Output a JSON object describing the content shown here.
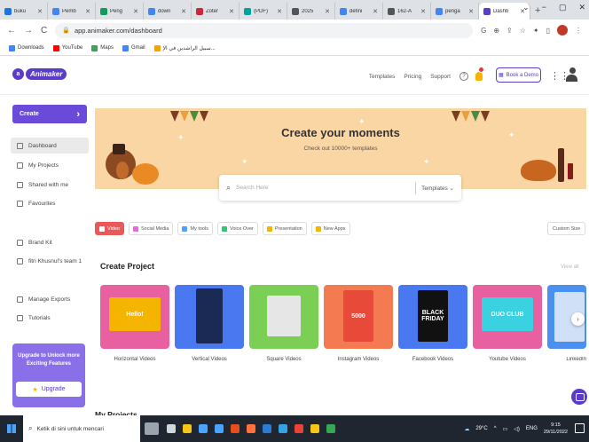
{
  "browser": {
    "tabs": [
      {
        "label": "buku",
        "color": "#1a73e8"
      },
      {
        "label": "Pemb",
        "color": "#4285f4"
      },
      {
        "label": "Peng",
        "color": "#0f9d58"
      },
      {
        "label": "down",
        "color": "#4285f4"
      },
      {
        "label": "Zoter",
        "color": "#cc2936"
      },
      {
        "label": "(PDF)",
        "color": "#00a39b"
      },
      {
        "label": "2025",
        "color": "#555555"
      },
      {
        "label": "defini",
        "color": "#4285f4"
      },
      {
        "label": "162-A",
        "color": "#555555"
      },
      {
        "label": "penga",
        "color": "#4285f4"
      },
      {
        "label": "Dashb",
        "color": "#5a3cc9",
        "active": true
      }
    ],
    "new_tab": "+",
    "window_controls": {
      "down": "⌄",
      "minimize": "−",
      "restore": "▢",
      "close": "✕"
    },
    "address": {
      "url": "app.animaker.com/dashboard",
      "lock_icon": "lock-icon"
    },
    "bookmarks": [
      {
        "label": "Downloads",
        "color": "#4285f4"
      },
      {
        "label": "YouTube",
        "color": "#ff0000"
      },
      {
        "label": "Maps",
        "color": "#34a853"
      },
      {
        "label": "Gmail",
        "color": "#4285f4"
      },
      {
        "label": "سبيل الراشدين في الإ...",
        "color": "#f4a300"
      }
    ]
  },
  "app": {
    "logo_text": "Animaker",
    "nav": {
      "templates": "Templates",
      "pricing": "Pricing",
      "support": "Support",
      "help": "?"
    },
    "book_demo": "Book a Demo",
    "colors": {
      "brand": "#5a3cc9",
      "banner": "#fbd6a5",
      "active_chip": "#e85a5a"
    }
  },
  "sidebar": {
    "create": "Create",
    "create_arrow": "›",
    "items": [
      {
        "label": "Dashboard",
        "active": true
      },
      {
        "label": "My Projects"
      },
      {
        "label": "Shared with me"
      },
      {
        "label": "Favourites"
      },
      {
        "label": "Brand Kit"
      },
      {
        "label": "fitri Khusnul's team 1"
      },
      {
        "label": "Manage Exports"
      },
      {
        "label": "Tutorials"
      }
    ],
    "upgrade": {
      "text": "Upgrade to Unlock more Exciting Features",
      "button": "Upgrade",
      "star": "★"
    }
  },
  "banner": {
    "title": "Create your moments",
    "subtitle": "Check out 10000+ templates"
  },
  "search": {
    "placeholder": "Search Here",
    "category": "Templates"
  },
  "chips": [
    {
      "label": "Video",
      "active": true,
      "color": "#ffffff"
    },
    {
      "label": "Social Media",
      "color": "#e66ad6"
    },
    {
      "label": "My tools",
      "color": "#4aa3ff"
    },
    {
      "label": "Voice Over",
      "color": "#35c27c"
    },
    {
      "label": "Presentation",
      "color": "#f5b400"
    },
    {
      "label": "New Apps",
      "color": "#f5b400"
    }
  ],
  "custom_size": "Custom Size",
  "create_project": {
    "title": "Create Project",
    "view_all": "View all",
    "cards": [
      {
        "label": "Horizontal Videos",
        "bg": "#e8609f",
        "screen_text": "Hello!"
      },
      {
        "label": "Vertical Videos",
        "bg": "#4a78f0",
        "screen_text": ""
      },
      {
        "label": "Square Videos",
        "bg": "#7ccf55",
        "screen_text": ""
      },
      {
        "label": "Instagram Videos",
        "bg": "#f47a52",
        "screen_text": "5000"
      },
      {
        "label": "Facebook Videos",
        "bg": "#4a78f0",
        "screen_text": "BLACK FRIDAY"
      },
      {
        "label": "Youtube Videos",
        "bg": "#e8609f",
        "screen_text": "DUO CLUB"
      },
      {
        "label": "LinkedIn",
        "bg": "#4a90f0",
        "screen_text": ""
      }
    ]
  },
  "my_projects": "My Projects",
  "taskbar": {
    "search_placeholder": "Ketik di sini untuk mencari",
    "apps": [
      {
        "name": "task-view",
        "color": "#cfd8dc"
      },
      {
        "name": "file-explorer",
        "color": "#f5c518"
      },
      {
        "name": "store",
        "color": "#4aa3ff"
      },
      {
        "name": "mail",
        "color": "#4aa3ff"
      },
      {
        "name": "office",
        "color": "#e84e1b"
      },
      {
        "name": "firefox",
        "color": "#ff7139"
      },
      {
        "name": "word",
        "color": "#2b7cd3"
      },
      {
        "name": "edge",
        "color": "#35a1e6"
      },
      {
        "name": "chrome",
        "color": "#ea4335"
      },
      {
        "name": "app",
        "color": "#f5c518"
      },
      {
        "name": "chrome-2",
        "color": "#34a853"
      }
    ],
    "weather": "29°C",
    "lang": "ENG",
    "time": "9:15",
    "date": "29/11/2022"
  }
}
